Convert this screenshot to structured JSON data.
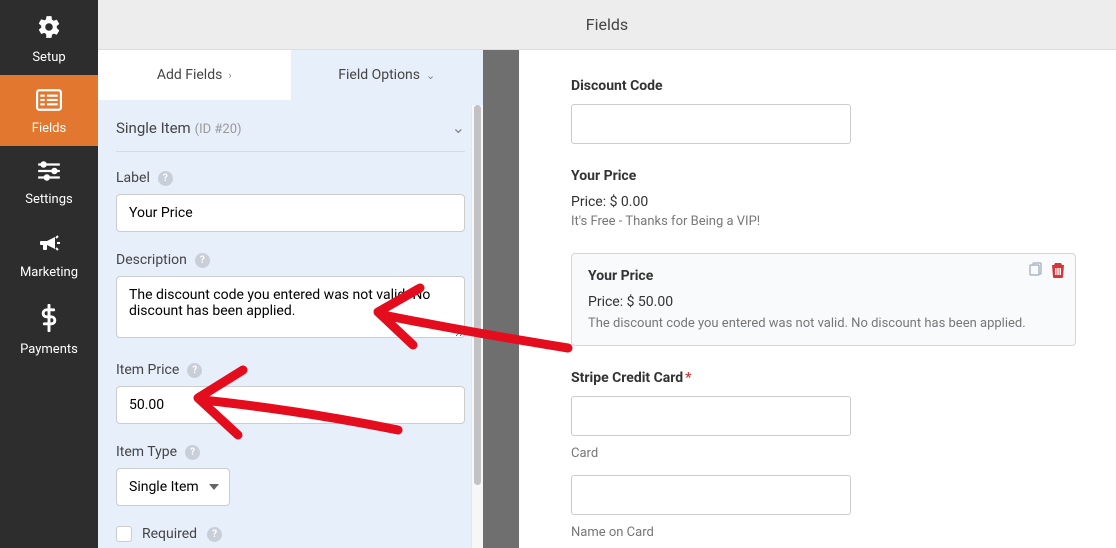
{
  "topbar": {
    "title": "Fields"
  },
  "sidebar": {
    "items": [
      {
        "label": "Setup",
        "icon": "gear"
      },
      {
        "label": "Fields",
        "icon": "list"
      },
      {
        "label": "Settings",
        "icon": "sliders"
      },
      {
        "label": "Marketing",
        "icon": "megaphone"
      },
      {
        "label": "Payments",
        "icon": "dollar"
      }
    ]
  },
  "tabs": {
    "add_fields": "Add Fields",
    "field_options": "Field Options"
  },
  "field": {
    "name": "Single Item",
    "id_label": "(ID #20)",
    "label_label": "Label",
    "label_value": "Your Price",
    "description_label": "Description",
    "description_value": "The discount code you entered was not valid. No discount has been applied.",
    "price_label": "Item Price",
    "price_value": "50.00",
    "type_label": "Item Type",
    "type_value": "Single Item",
    "required_label": "Required"
  },
  "preview": {
    "discount_label": "Discount Code",
    "your_price_label": "Your Price",
    "price_zero": "Price: $ 0.00",
    "free_text": "It's Free - Thanks for Being a VIP!",
    "selected_label": "Your Price",
    "price_fifty": "Price: $ 50.00",
    "error_text": "The discount code you entered was not valid. No discount has been applied.",
    "stripe_label": "Stripe Credit Card",
    "card_label": "Card",
    "name_label": "Name on Card"
  }
}
